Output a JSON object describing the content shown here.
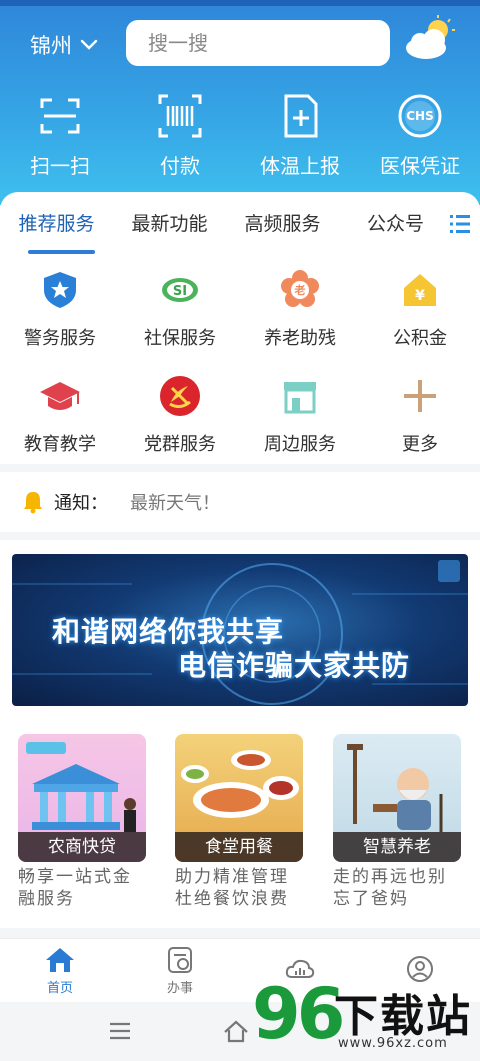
{
  "header": {
    "city": "锦州",
    "search_placeholder": "搜一搜"
  },
  "quick_actions": [
    {
      "label": "扫一扫",
      "icon": "scan-icon"
    },
    {
      "label": "付款",
      "icon": "barcode-icon"
    },
    {
      "label": "体温上报",
      "icon": "report-doc-icon"
    },
    {
      "label": "医保凭证",
      "icon": "chs-badge-icon"
    }
  ],
  "tabs": [
    {
      "label": "推荐服务",
      "active": true
    },
    {
      "label": "最新功能",
      "active": false
    },
    {
      "label": "高频服务",
      "active": false
    },
    {
      "label": "公众号",
      "active": false
    }
  ],
  "services": [
    {
      "label": "警务服务",
      "icon": "police-shield-icon"
    },
    {
      "label": "社保服务",
      "icon": "social-security-icon"
    },
    {
      "label": "养老助残",
      "icon": "elderly-care-icon"
    },
    {
      "label": "公积金",
      "icon": "housing-fund-icon"
    },
    {
      "label": "教育教学",
      "icon": "graduation-cap-icon"
    },
    {
      "label": "党群服务",
      "icon": "party-emblem-icon"
    },
    {
      "label": "周边服务",
      "icon": "storefront-icon"
    },
    {
      "label": "更多",
      "icon": "plus-icon"
    }
  ],
  "notice": {
    "label": "通知：",
    "text": "最新天气！"
  },
  "banner": {
    "line1": "和谐网络你我共享",
    "line2": "电信诈骗大家共防"
  },
  "cards": [
    {
      "caption": "农商快贷",
      "desc": "畅享一站式金融服务"
    },
    {
      "caption": "食堂用餐",
      "desc": "助力精准管理杜绝餐饮浪费"
    },
    {
      "caption": "智慧养老",
      "desc": "走的再远也别忘了爸妈"
    }
  ],
  "bottom_nav": [
    {
      "label": "首页",
      "active": true,
      "icon": "home-icon"
    },
    {
      "label": "办事",
      "active": false,
      "icon": "tasks-icon"
    },
    {
      "label": "",
      "active": false,
      "icon": "cloud-data-icon"
    },
    {
      "label": "",
      "active": false,
      "icon": "profile-icon"
    }
  ],
  "watermark": {
    "number": "96",
    "title": "下载站",
    "url": "www.96xz.com"
  },
  "colors": {
    "header_top": "#2f86d9",
    "header_bottom": "#3fc0ee",
    "accent": "#2a7bd3"
  }
}
